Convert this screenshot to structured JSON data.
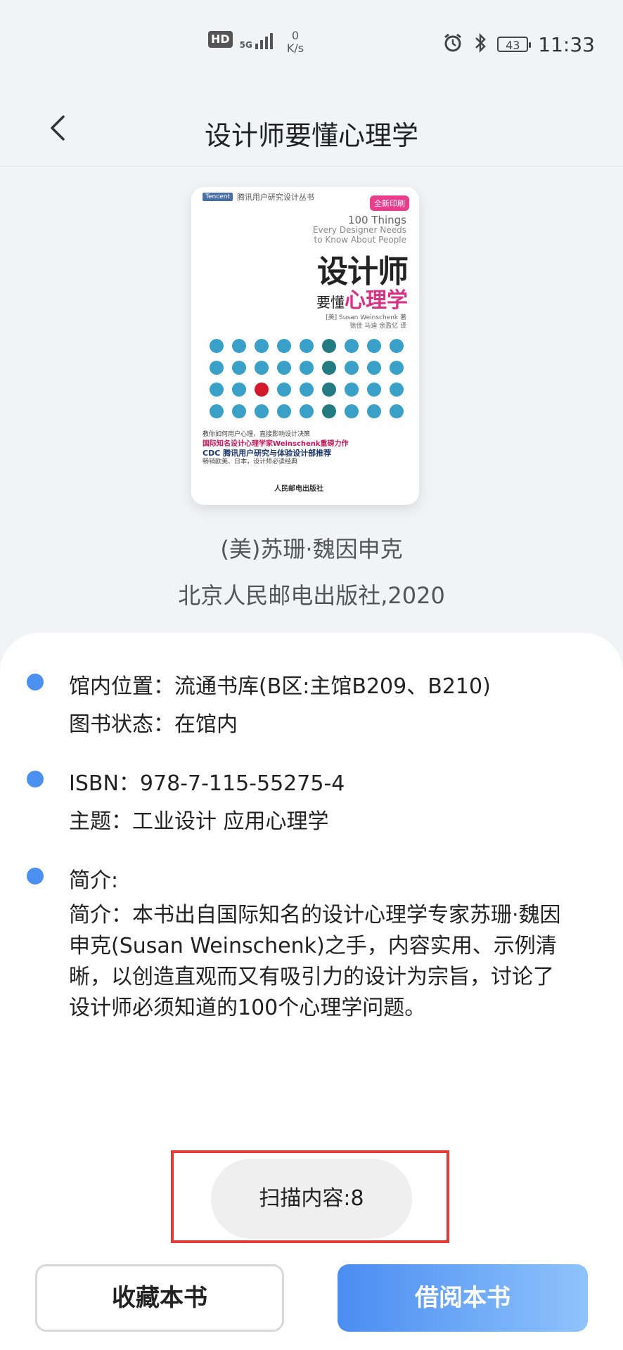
{
  "status_bar": {
    "hd": "HD",
    "network": "5G",
    "speed_value": "0",
    "speed_unit": "K/s",
    "battery": "43",
    "time": "11:33",
    "icons": [
      "hd-icon",
      "signal-icon",
      "alarm-icon",
      "bluetooth-icon",
      "battery-icon"
    ]
  },
  "header": {
    "title": "设计师要懂心理学",
    "back_icon": "chevron-left-icon"
  },
  "book": {
    "cover": {
      "series": "腾讯用户研究设计丛书",
      "series_tag": "Tencent",
      "badge": "全新印刷",
      "en_title_1": "100 Things",
      "en_title_2": "Every Designer Needs",
      "en_title_3": "to Know About People",
      "title": "设计师",
      "sub_prefix": "要懂",
      "sub_highlight": "心理学",
      "author_line": "[美] Susan Weinschenk 著",
      "translator_line": "徐佳 马迪 余盈亿 译",
      "blurb_1": "教你如何用户心理，直接影响设计决策",
      "blurb_2": "国际知名设计心理学家Weinschenk重磅力作",
      "blurb_3": "CDC 腾讯用户研究与体验设计部推荐",
      "blurb_4": "畅销欧美、日本，设计师必读经典",
      "publisher": "人民邮电出版社",
      "dots_rows": 4,
      "dots_cols": 9,
      "dot_colors": {
        "normal": "#3aa0c8",
        "dark": "#237a80",
        "red": "#d21a2a"
      }
    },
    "author": "(美)苏珊·魏因申克",
    "publisher_year": "北京人民邮电出版社,2020"
  },
  "details": {
    "location_label": "馆内位置：",
    "location_value": "流通书库(B区:主馆B209、B210)",
    "status_label": "图书状态：",
    "status_value": "在馆内",
    "isbn_label": "ISBN：",
    "isbn_value": "978-7-115-55275-4",
    "subject_label": "主题：",
    "subject_value": "工业设计 应用心理学",
    "intro_label": "简介:",
    "intro_text": "简介：本书出自国际知名的设计心理学专家苏珊·魏因申克(Susan Weinschenk)之手，内容实用、示例清晰，以创造直观而又有吸引力的设计为宗旨，讨论了设计师必须知道的100个心理学问题。"
  },
  "scan": {
    "label": "扫描内容:8"
  },
  "actions": {
    "favorite": "收藏本书",
    "borrow": "借阅本书"
  },
  "colors": {
    "accent": "#4b8ff0",
    "highlight_frame": "#e53935",
    "background": "#f2f3f5"
  }
}
